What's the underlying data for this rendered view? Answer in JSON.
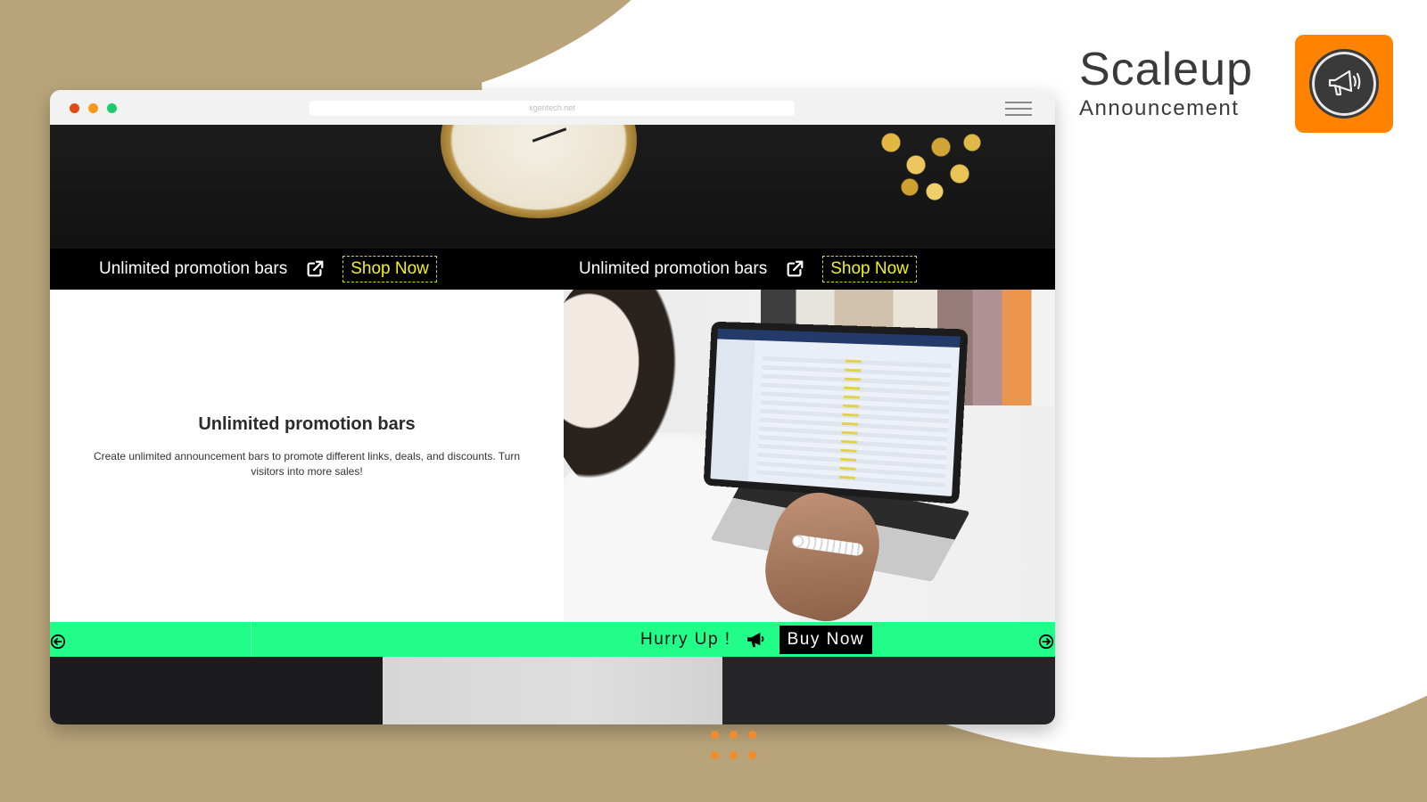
{
  "brand": {
    "title": "Scaleup",
    "subtitle": "Announcement",
    "logo_icon": "megaphone-icon",
    "accent_color": "#ff8300"
  },
  "browser": {
    "url": "xgentech.net",
    "window_controls": [
      "close",
      "minimize",
      "maximize"
    ],
    "menu_icon": "hamburger-menu-icon"
  },
  "promo_bar": {
    "background": "#000000",
    "items": [
      {
        "text": "Unlimited promotion bars",
        "link_icon": "external-link-icon",
        "button_label": "Shop Now"
      },
      {
        "text": "Unlimited promotion bars",
        "link_icon": "external-link-icon",
        "button_label": "Shop Now"
      }
    ],
    "button_color": "#f3f31a"
  },
  "feature": {
    "title": "Unlimited promotion bars",
    "description": "Create unlimited announcement bars to promote different links, deals, and discounts. Turn visitors into more sales!",
    "image_alt": "person using laptop showing orders dashboard"
  },
  "hurry_bar": {
    "background": "#22fd8a",
    "text": "Hurry Up !",
    "icon": "megaphone-icon",
    "button_label": "Buy Now",
    "prev_icon": "arrow-left-circle-icon",
    "next_icon": "arrow-right-circle-icon"
  }
}
